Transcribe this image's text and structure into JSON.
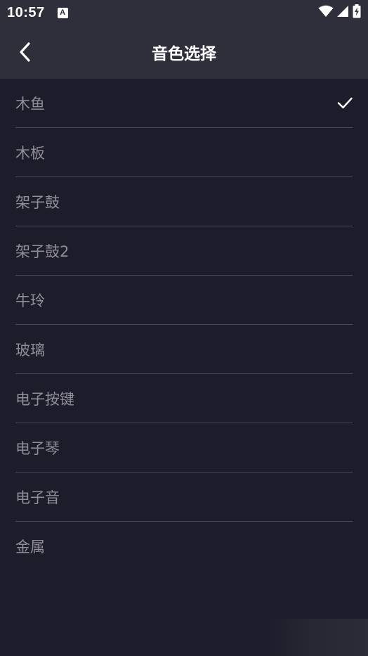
{
  "status_bar": {
    "time": "10:57",
    "notification_badge": "A",
    "icons": [
      "wifi-icon",
      "signal-icon",
      "battery-charging-icon"
    ]
  },
  "header": {
    "title": "音色选择",
    "back_icon": "chevron-left-icon"
  },
  "list": {
    "selected_index": 0,
    "items": [
      {
        "label": "木鱼",
        "selected": true
      },
      {
        "label": "木板",
        "selected": false
      },
      {
        "label": "架子鼓",
        "selected": false
      },
      {
        "label": "架子鼓2",
        "selected": false
      },
      {
        "label": "牛玲",
        "selected": false
      },
      {
        "label": "玻璃",
        "selected": false
      },
      {
        "label": "电子按键",
        "selected": false
      },
      {
        "label": "电子琴",
        "selected": false
      },
      {
        "label": "电子音",
        "selected": false
      },
      {
        "label": "金属",
        "selected": false
      }
    ]
  },
  "colors": {
    "background": "#1d1c2a",
    "header": "#2f2e3b",
    "item_text": "#8f8e98",
    "divider": "#4a4957",
    "title": "#ffffff"
  }
}
